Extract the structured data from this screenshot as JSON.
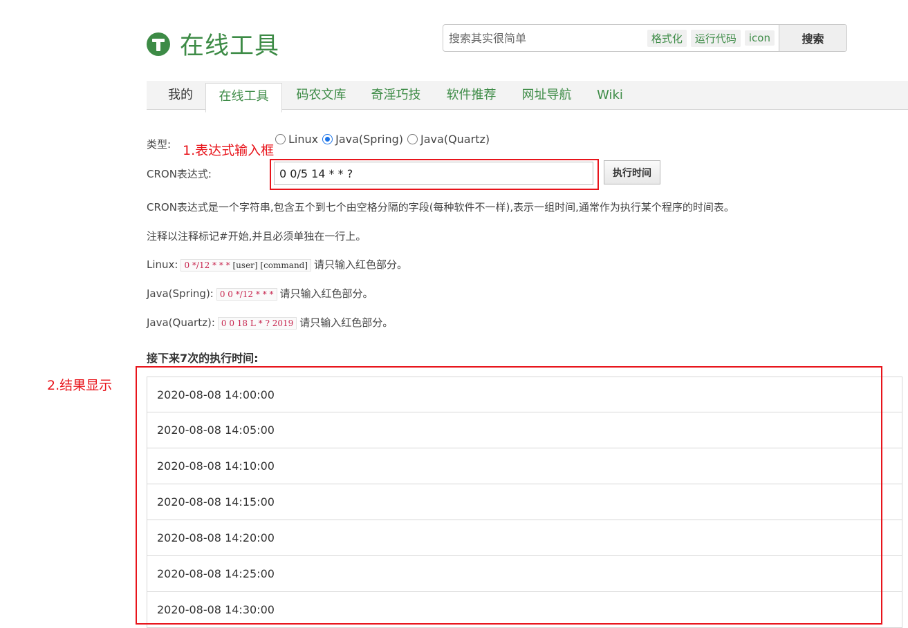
{
  "header": {
    "logo_text": "在线工具",
    "search": {
      "placeholder": "搜索其实很简单",
      "tags": [
        "格式化",
        "运行代码",
        "icon"
      ],
      "button_label": "搜索"
    }
  },
  "nav": {
    "items": [
      "我的",
      "在线工具",
      "码农文库",
      "奇淫巧技",
      "软件推荐",
      "网址导航",
      "Wiki"
    ],
    "active": "在线工具"
  },
  "form": {
    "type_label": "类型:",
    "radio_options": [
      "Linux",
      "Java(Spring)",
      "Java(Quartz)"
    ],
    "selected_option": "Java(Spring)",
    "annotation_input": "1.表达式输入框",
    "cron_label": "CRON表达式:",
    "cron_value": "0 0/5 14 * * ?",
    "exec_button": "执行时间"
  },
  "description": {
    "intro": "CRON表达式是一个字符串,包含五个到七个由空格分隔的字段(每种软件不一样),表示一组时间,通常作为执行某个程序的时间表。",
    "comment_note": "注释以注释标记#开始,并且必须单独在一行上。",
    "linux_label": "Linux:",
    "linux_red": "0 */12 * * *",
    "linux_black": " [user] [command]",
    "spring_label": "Java(Spring):",
    "spring_red": "0 0 */12 * * *",
    "quartz_label": "Java(Quartz):",
    "quartz_red": "0 0 18 L * ? 2019",
    "suffix": "请只输入红色部分。"
  },
  "results": {
    "title": "接下来7次的执行时间:",
    "annotation": "2.结果显示",
    "times": [
      "2020-08-08 14:00:00",
      "2020-08-08 14:05:00",
      "2020-08-08 14:10:00",
      "2020-08-08 14:15:00",
      "2020-08-08 14:20:00",
      "2020-08-08 14:25:00",
      "2020-08-08 14:30:00"
    ]
  },
  "colors": {
    "brand_green": "#3d8b46",
    "annotation_red": "#e8141b",
    "code_red": "#c7254e"
  }
}
